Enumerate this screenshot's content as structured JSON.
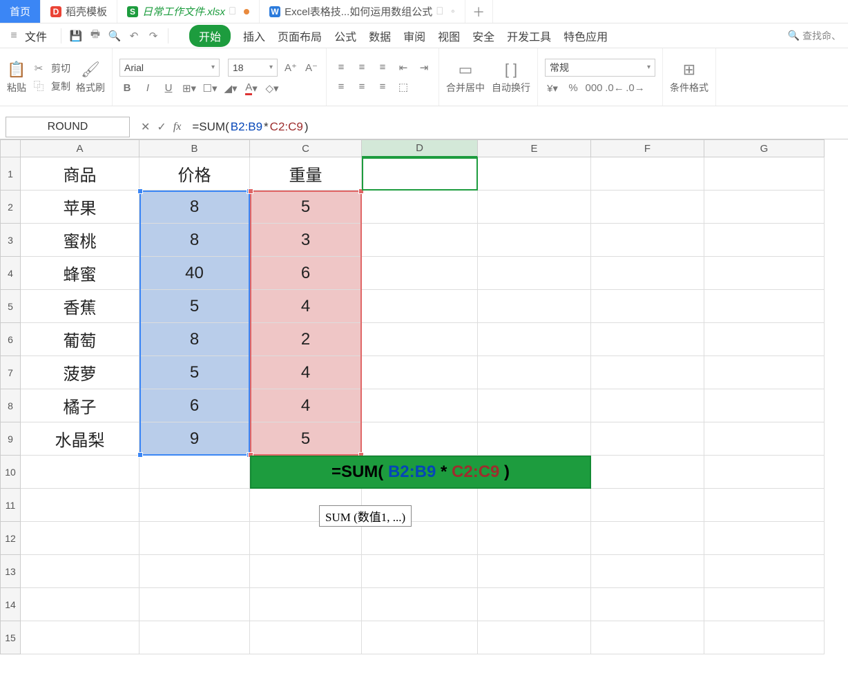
{
  "tabs": {
    "home": "首页",
    "t1": "稻壳模板",
    "t2": "日常工作文件.xlsx",
    "t3": "Excel表格技...如何运用数组公式"
  },
  "menu": {
    "file": "文件",
    "items": [
      "开始",
      "插入",
      "页面布局",
      "公式",
      "数据",
      "审阅",
      "视图",
      "安全",
      "开发工具",
      "特色应用"
    ],
    "search_placeholder": "查找命、"
  },
  "ribbon": {
    "paste": "粘贴",
    "cut": "剪切",
    "copy": "复制",
    "fmtpaint": "格式刷",
    "font": "Arial",
    "size": "18",
    "merge": "合并居中",
    "wrap": "自动换行",
    "numfmt": "常规",
    "condfmt": "条件格式"
  },
  "fx": {
    "namebox": "ROUND",
    "formula_full": "=SUM(B2:B9*C2:C9)",
    "formula_prefix": "=SUM(",
    "formula_arg1": "B2:B9",
    "formula_mid": "*",
    "formula_arg2": "C2:C9",
    "formula_suffix": ")"
  },
  "columns": [
    "A",
    "B",
    "C",
    "D",
    "E",
    "F",
    "G"
  ],
  "sheet": {
    "header": {
      "A": "商品",
      "B": "价格",
      "C": "重量"
    },
    "rows": [
      {
        "A": "苹果",
        "B": "8",
        "C": "5"
      },
      {
        "A": "蜜桃",
        "B": "8",
        "C": "3"
      },
      {
        "A": "蜂蜜",
        "B": "40",
        "C": "6"
      },
      {
        "A": "香蕉",
        "B": "5",
        "C": "4"
      },
      {
        "A": "葡萄",
        "B": "8",
        "C": "2"
      },
      {
        "A": "菠萝",
        "B": "5",
        "C": "4"
      },
      {
        "A": "橘子",
        "B": "6",
        "C": "4"
      },
      {
        "A": "水晶梨",
        "B": "9",
        "C": "5"
      }
    ],
    "row10_formula_prefix": "=SUM( ",
    "row10_arg1": "B2:B9",
    "row10_mid": " * ",
    "row10_arg2": "C2:C9",
    "row10_suffix": " )"
  },
  "tooltip": "SUM (数值1, ...)",
  "chart_data": null
}
